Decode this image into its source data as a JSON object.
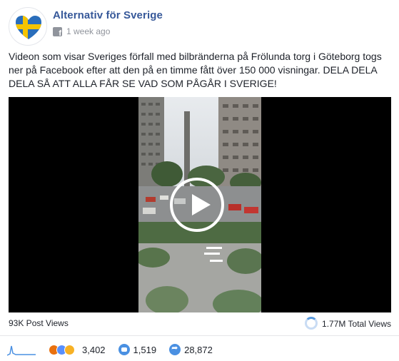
{
  "post": {
    "page_name": "Alternativ för Sverige",
    "timestamp": "1 week ago",
    "text": "Videon som visar Sveriges förfall med bilbränderna på Frölunda torg i Göteborg togs ner på Facebook efter att den på en timme fått över 150 000 visningar. DELA DELA DELA SÅ ATT ALLA FÅR SE VAD SOM PÅGÅR I SVERIGE!"
  },
  "video": {
    "play_icon": "play-icon"
  },
  "stats": {
    "post_views": "93K Post Views",
    "total_views": "1.77M Total Views"
  },
  "engagement": {
    "reactions": "3,402",
    "comments": "1,519",
    "shares": "28,872"
  },
  "colors": {
    "link_blue": "#365899",
    "meta_gray": "#90949c",
    "video_bg": "#000000",
    "accent_blue": "#4a90e2",
    "flag_blue": "#2a6ebb",
    "flag_yellow": "#f5c400"
  }
}
